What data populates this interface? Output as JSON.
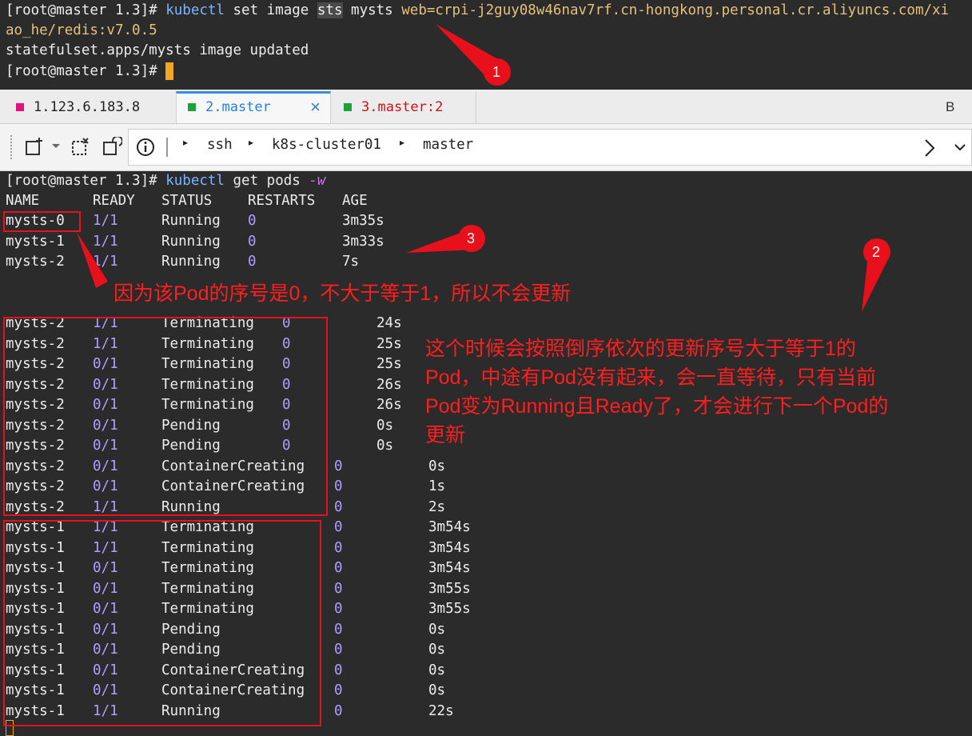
{
  "top_terminal": {
    "line1": {
      "prompt": "[root@master 1.3]",
      "hash": "#",
      "cmd": "kubectl",
      "args_before": " set image ",
      "sts": "sts",
      "args_after": " mysts ",
      "image_part1": "web=crpi-j2guy08w46nav7rf.cn-hongkong.personal.cr.aliyuncs.com/xi"
    },
    "line2": "ao_he/redis:v7.0.5",
    "line3": "statefulset.apps/mysts image updated",
    "line4": {
      "prompt": "[root@master 1.3]",
      "hash": "#"
    }
  },
  "tabs": [
    {
      "label": "1.123.6.183.8",
      "color": "#e8107a"
    },
    {
      "label": "2.master",
      "color": "#1aa33a",
      "active": true,
      "close": "×"
    },
    {
      "label": "3.master:2",
      "color": "#1aa33a",
      "label_color": "#d0101a"
    }
  ],
  "tab_overflow_label": "B",
  "toolbar": {
    "breadcrumb": [
      "ssh",
      "k8s-cluster01",
      "master"
    ]
  },
  "main_terminal": {
    "command": {
      "prompt": "[root@master 1.3]",
      "hash": "#",
      "cmd": "kubectl",
      "args": " get pods ",
      "flag": "-w"
    },
    "headers": [
      "NAME",
      "READY",
      "STATUS",
      "RESTARTS",
      "AGE"
    ],
    "rows_initial": [
      {
        "name": "mysts-0",
        "ready": "1/1",
        "status": "Running",
        "restarts": "0",
        "age": "3m35s"
      },
      {
        "name": "mysts-1",
        "ready": "1/1",
        "status": "Running",
        "restarts": "0",
        "age": "3m33s"
      },
      {
        "name": "mysts-2",
        "ready": "1/1",
        "status": "Running",
        "restarts": "0",
        "age": "7s"
      }
    ],
    "rows_watch": [
      {
        "name": "mysts-2",
        "ready": "1/1",
        "status": "Terminating",
        "restarts": "0",
        "age": "24s"
      },
      {
        "name": "mysts-2",
        "ready": "1/1",
        "status": "Terminating",
        "restarts": "0",
        "age": "25s"
      },
      {
        "name": "mysts-2",
        "ready": "0/1",
        "status": "Terminating",
        "restarts": "0",
        "age": "25s"
      },
      {
        "name": "mysts-2",
        "ready": "0/1",
        "status": "Terminating",
        "restarts": "0",
        "age": "26s"
      },
      {
        "name": "mysts-2",
        "ready": "0/1",
        "status": "Terminating",
        "restarts": "0",
        "age": "26s"
      },
      {
        "name": "mysts-2",
        "ready": "0/1",
        "status": "Pending",
        "restarts": "0",
        "age": "0s"
      },
      {
        "name": "mysts-2",
        "ready": "0/1",
        "status": "Pending",
        "restarts": "0",
        "age": "0s"
      },
      {
        "name": "mysts-2",
        "ready": "0/1",
        "status": "ContainerCreating",
        "restarts": "0",
        "age": "0s"
      },
      {
        "name": "mysts-2",
        "ready": "0/1",
        "status": "ContainerCreating",
        "restarts": "0",
        "age": "1s"
      },
      {
        "name": "mysts-2",
        "ready": "1/1",
        "status": "Running",
        "restarts": "0",
        "age": "2s"
      },
      {
        "name": "mysts-1",
        "ready": "1/1",
        "status": "Terminating",
        "restarts": "0",
        "age": "3m54s"
      },
      {
        "name": "mysts-1",
        "ready": "1/1",
        "status": "Terminating",
        "restarts": "0",
        "age": "3m54s"
      },
      {
        "name": "mysts-1",
        "ready": "0/1",
        "status": "Terminating",
        "restarts": "0",
        "age": "3m54s"
      },
      {
        "name": "mysts-1",
        "ready": "0/1",
        "status": "Terminating",
        "restarts": "0",
        "age": "3m55s"
      },
      {
        "name": "mysts-1",
        "ready": "0/1",
        "status": "Terminating",
        "restarts": "0",
        "age": "3m55s"
      },
      {
        "name": "mysts-1",
        "ready": "0/1",
        "status": "Pending",
        "restarts": "0",
        "age": "0s"
      },
      {
        "name": "mysts-1",
        "ready": "0/1",
        "status": "Pending",
        "restarts": "0",
        "age": "0s"
      },
      {
        "name": "mysts-1",
        "ready": "0/1",
        "status": "ContainerCreating",
        "restarts": "0",
        "age": "0s"
      },
      {
        "name": "mysts-1",
        "ready": "0/1",
        "status": "ContainerCreating",
        "restarts": "0",
        "age": "0s"
      },
      {
        "name": "mysts-1",
        "ready": "1/1",
        "status": "Running",
        "restarts": "0",
        "age": "22s"
      }
    ]
  },
  "annotations": {
    "marker1": "1",
    "marker2": "2",
    "marker3": "3",
    "note_pod0": "因为该Pod的序号是0，不大于等于1，所以不会更新",
    "note_order_lines": [
      "这个时候会按照倒序依次的更新序号大于等于1的",
      "Pod，中途有Pod没有起来，会一直等待，只有当前",
      "Pod变为Running且Ready了，才会进行下一个Pod的",
      "更新"
    ]
  }
}
